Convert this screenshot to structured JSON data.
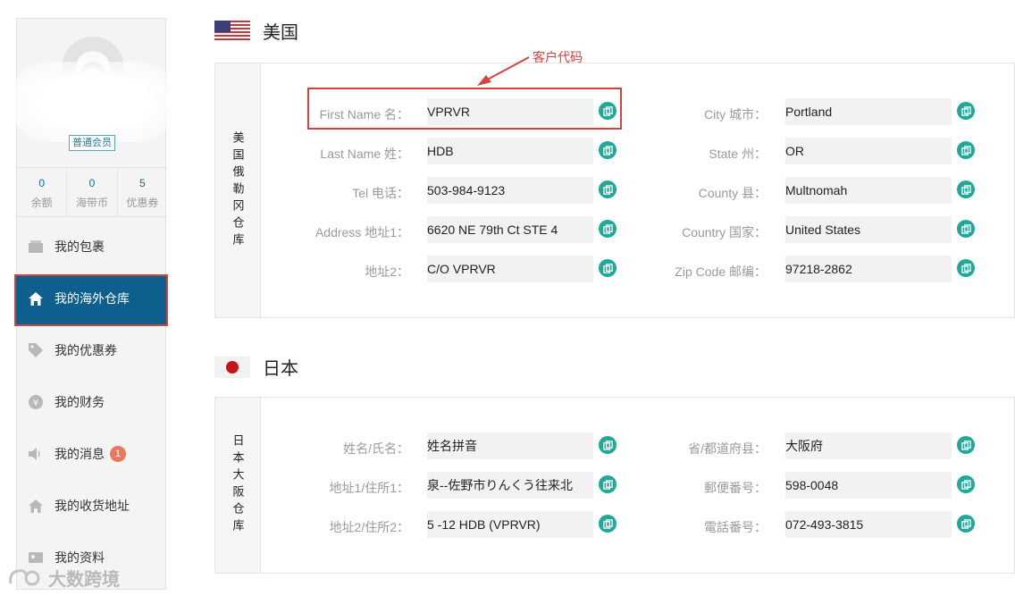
{
  "sidebar": {
    "member_badge": "普通会员",
    "stats": [
      {
        "num": "0",
        "label": "余额"
      },
      {
        "num": "0",
        "label": "海带币"
      },
      {
        "num": "5",
        "label": "优惠券"
      }
    ],
    "nav": [
      {
        "label": "我的包裹",
        "icon": "package-icon"
      },
      {
        "label": "我的海外仓库",
        "icon": "home-icon"
      },
      {
        "label": "我的优惠券",
        "icon": "tag-icon"
      },
      {
        "label": "我的财务",
        "icon": "yen-icon"
      },
      {
        "label": "我的消息",
        "icon": "speaker-icon",
        "badge": "1"
      },
      {
        "label": "我的收货地址",
        "icon": "home-icon"
      },
      {
        "label": "我的资料",
        "icon": "id-card-icon"
      }
    ]
  },
  "annotation": {
    "label": "客户代码"
  },
  "us": {
    "title": "美国",
    "warehouse_label": "美国俄勒冈仓库",
    "left_fields": [
      {
        "label": "First Name 名：",
        "value": "VPRVR"
      },
      {
        "label": "Last Name 姓：",
        "value": "HDB"
      },
      {
        "label": "Tel 电话：",
        "value": "503-984-9123"
      },
      {
        "label": "Address 地址1：",
        "value": "6620 NE 79th Ct STE 4"
      },
      {
        "label": "地址2：",
        "value": "C/O VPRVR"
      }
    ],
    "right_fields": [
      {
        "label": "City 城市：",
        "value": "Portland"
      },
      {
        "label": "State 州：",
        "value": "OR"
      },
      {
        "label": "County 县：",
        "value": "Multnomah"
      },
      {
        "label": "Country 国家：",
        "value": "United States"
      },
      {
        "label": "Zip Code 邮编：",
        "value": "97218-2862"
      }
    ]
  },
  "jp": {
    "title": "日本",
    "warehouse_label": "日本大阪仓库",
    "left_fields": [
      {
        "label": "姓名/氏名：",
        "value": "姓名拼音"
      },
      {
        "label": "地址1/住所1：",
        "value": "泉--佐野市りんくう往来北"
      },
      {
        "label": "地址2/住所2：",
        "value": "5 -12 HDB (VPRVR)"
      }
    ],
    "right_fields": [
      {
        "label": "省/都道府县：",
        "value": "大阪府"
      },
      {
        "label": "郵便番号：",
        "value": "598-0048"
      },
      {
        "label": "電話番号：",
        "value": "072-493-3815"
      }
    ]
  },
  "watermark": {
    "text": "大数跨境"
  },
  "colors": {
    "accent": "#0d5f8d",
    "highlight": "#d3443f",
    "copy_button": "#21a89a"
  }
}
